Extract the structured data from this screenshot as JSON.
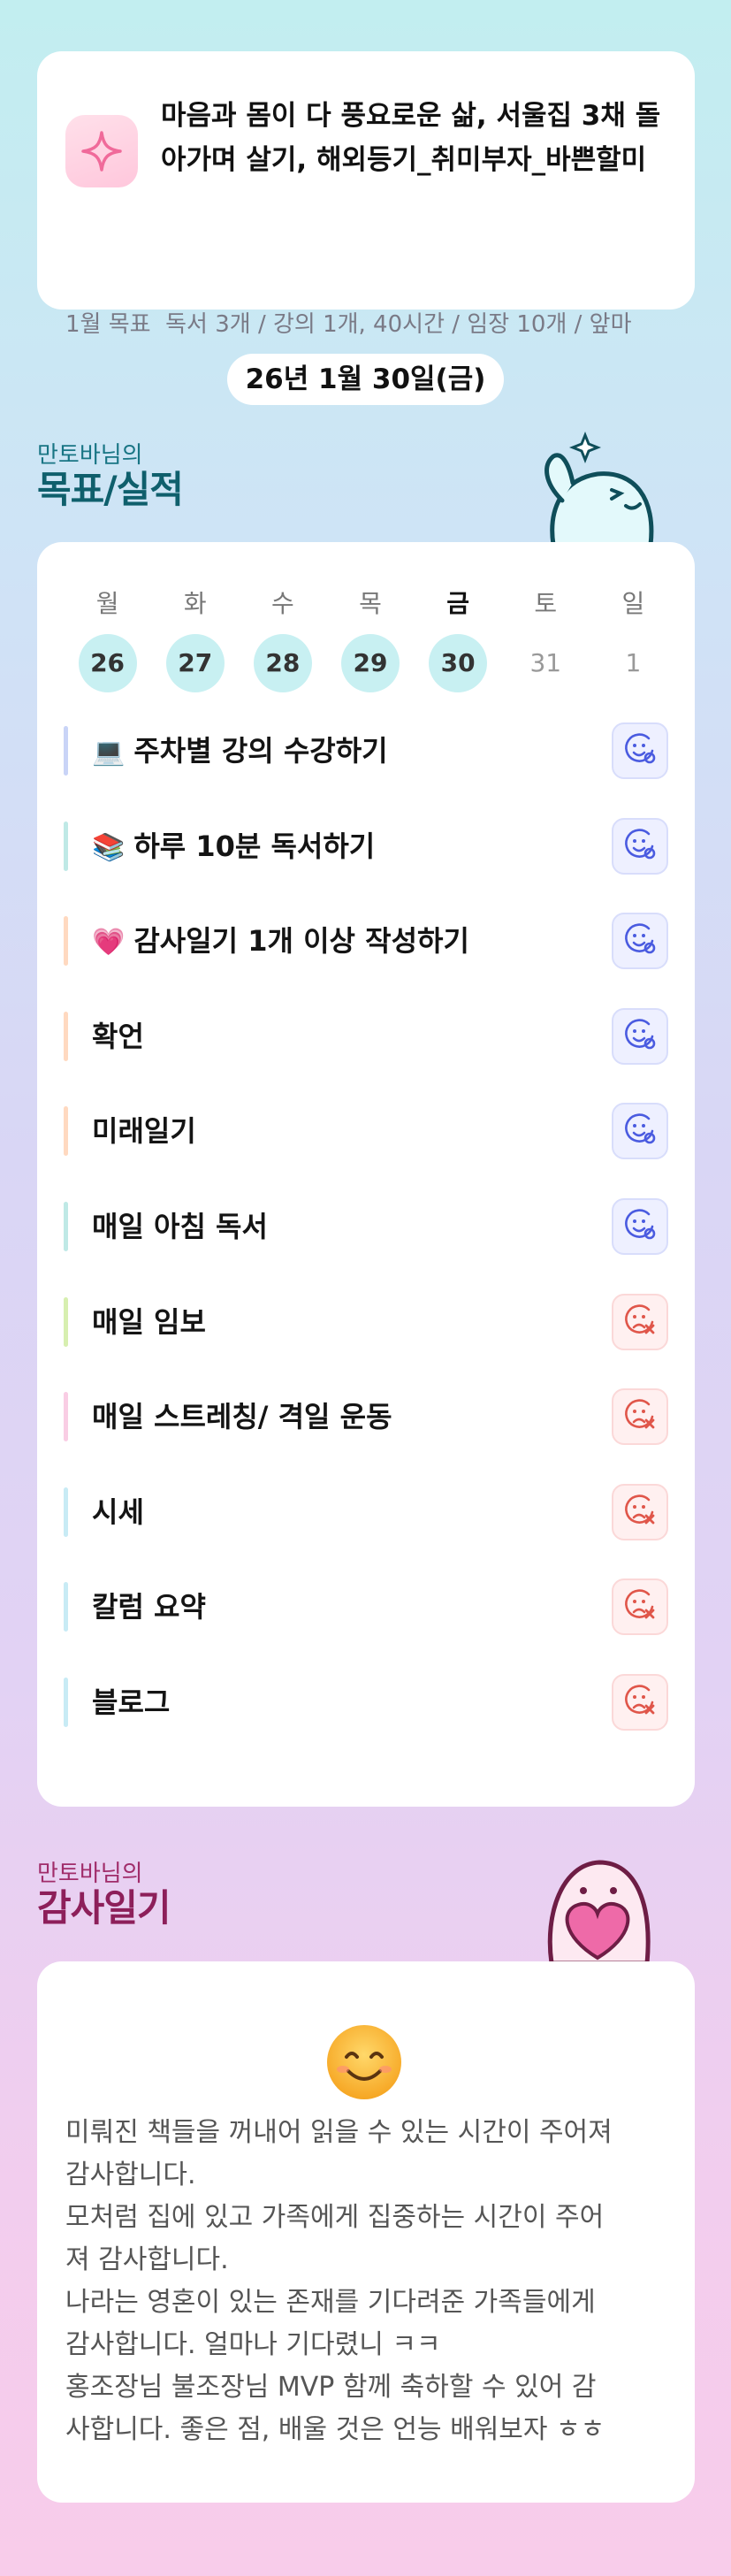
{
  "goal": {
    "title": "마음과 몸이 다 풍요로운 삶, 서울집 3채 돌아가며 살기, 해외등기_취미부자_바쁜할미",
    "monthly_label": "1월 목표",
    "monthly_value": "독서 3개 / 강의 1개, 40시간 / 임장 10개 / 앞마"
  },
  "date": "26년 1월 30일(금)",
  "goals_section": {
    "owner": "만토바님의",
    "title": "목표/실적"
  },
  "week": [
    {
      "day": "월",
      "date": "26",
      "state": "done"
    },
    {
      "day": "화",
      "date": "27",
      "state": "done"
    },
    {
      "day": "수",
      "date": "28",
      "state": "done"
    },
    {
      "day": "목",
      "date": "29",
      "state": "done"
    },
    {
      "day": "금",
      "date": "30",
      "state": "done",
      "today": true
    },
    {
      "day": "토",
      "date": "31",
      "state": "future"
    },
    {
      "day": "일",
      "date": "1",
      "state": "future"
    }
  ],
  "goals": [
    {
      "emoji": "💻",
      "label": "주차별 강의 수강하기",
      "status": "done",
      "bar": "#c9d4f7"
    },
    {
      "emoji": "📚",
      "label": "하루 10분 독서하기",
      "status": "done",
      "bar": "#bfe9e6"
    },
    {
      "emoji": "💗",
      "label": "감사일기 1개 이상 작성하기",
      "status": "done",
      "bar": "#ffd9c0"
    },
    {
      "emoji": "",
      "label": "확언",
      "status": "done",
      "bar": "#ffd9c0"
    },
    {
      "emoji": "",
      "label": "미래일기",
      "status": "done",
      "bar": "#ffd9c0"
    },
    {
      "emoji": "",
      "label": "매일 아침 독서",
      "status": "done",
      "bar": "#bfe9e6"
    },
    {
      "emoji": "",
      "label": "매일 임보",
      "status": "fail",
      "bar": "#d7efb0"
    },
    {
      "emoji": "",
      "label": "매일 스트레칭/ 격일 운동",
      "status": "fail",
      "bar": "#f9cde4"
    },
    {
      "emoji": "",
      "label": "시세",
      "status": "fail",
      "bar": "#c8ebf5"
    },
    {
      "emoji": "",
      "label": "칼럼 요약",
      "status": "fail",
      "bar": "#c8ebf5"
    },
    {
      "emoji": "",
      "label": "블로그",
      "status": "fail",
      "bar": "#c8ebf5"
    }
  ],
  "thanks_section": {
    "owner": "만토바님의",
    "title": "감사일기"
  },
  "thanks": {
    "emoji": "smiling-face",
    "lines": [
      "미뤄진 책들을 꺼내어 읽을 수 있는 시간이 주어져",
      "감사합니다.",
      "모처럼 집에 있고 가족에게 집중하는 시간이 주어",
      "져 감사합니다.",
      "나라는 영혼이 있는 존재를 기다려준 가족들에게",
      "감사합니다. 얼마나 기다렸니 ㅋㅋ",
      "홍조장님 불조장님 MVP 함께 축하할 수 있어 감",
      "사합니다. 좋은 점, 배울 것은 언능 배워보자 ㅎㅎ"
    ]
  },
  "colors": {
    "ok_icon": "#4a5be0",
    "fail_icon": "#e0564a",
    "done_circle": "#c8f0f2"
  }
}
